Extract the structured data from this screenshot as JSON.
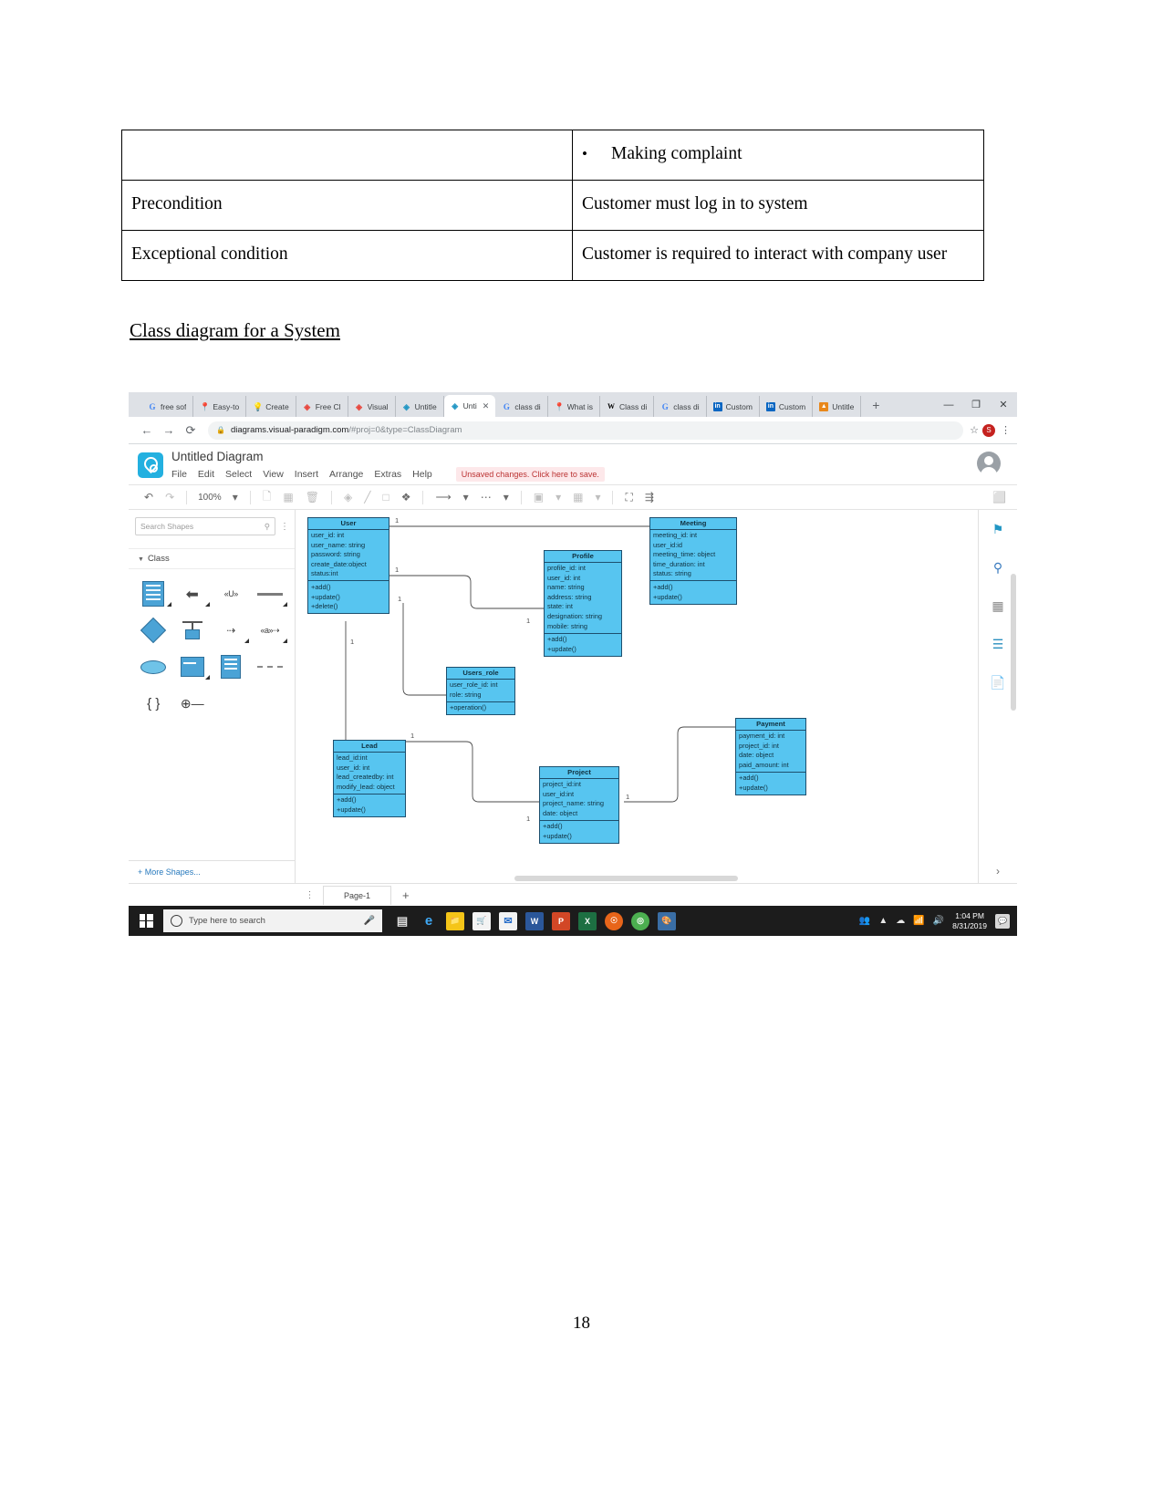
{
  "document": {
    "table_rows": [
      {
        "label": "",
        "value": "Making complaint",
        "is_bullet": true
      },
      {
        "label": "Precondition",
        "value": "Customer must log in to system",
        "is_bullet": false
      },
      {
        "label": "Exceptional condition",
        "value": "Customer is required to interact with company user",
        "is_bullet": false
      }
    ],
    "heading": "Class diagram for a System",
    "page_number": "18"
  },
  "browser": {
    "tabs": [
      {
        "label": "free sof",
        "icon": "google-icon",
        "active": false
      },
      {
        "label": "Easy-to",
        "icon": "pin-icon",
        "active": false
      },
      {
        "label": "Create",
        "icon": "bulb-icon",
        "active": false
      },
      {
        "label": "Free Cl",
        "icon": "visual-paradigm-icon",
        "active": false
      },
      {
        "label": "Visual",
        "icon": "visual-paradigm-icon",
        "active": false
      },
      {
        "label": "Untitle",
        "icon": "diagrams-icon",
        "active": false
      },
      {
        "label": "Unti",
        "icon": "diagrams-icon",
        "active": true
      },
      {
        "label": "class di",
        "icon": "google-icon",
        "active": false
      },
      {
        "label": "What is",
        "icon": "pin-icon",
        "active": false
      },
      {
        "label": "Class di",
        "icon": "wikipedia-icon",
        "active": false
      },
      {
        "label": "class di",
        "icon": "google-icon",
        "active": false
      },
      {
        "label": "Custom",
        "icon": "linkedin-icon",
        "active": false
      },
      {
        "label": "Custom",
        "icon": "linkedin-icon",
        "active": false
      },
      {
        "label": "Untitle",
        "icon": "orange-app-icon",
        "active": false
      }
    ],
    "new_tab_label": "+",
    "window_controls": {
      "minimize": "—",
      "maximize": "❐",
      "close": "✕"
    },
    "url_host": "diagrams.visual-paradigm.com",
    "url_path": "/#proj=0&type=ClassDiagram",
    "profile_initial": "S"
  },
  "app": {
    "title": "Untitled Diagram",
    "menu": [
      "File",
      "Edit",
      "Select",
      "View",
      "Insert",
      "Arrange",
      "Extras",
      "Help"
    ],
    "unsaved_notice": "Unsaved changes. Click here to save.",
    "toolbar": {
      "zoom": "100%",
      "undo": "↶",
      "redo": "↷"
    },
    "shapes_panel": {
      "search_placeholder": "Search Shapes",
      "group_label": "Class",
      "more_shapes_label": "+ More Shapes..."
    },
    "page_tab": "Page-1",
    "add_page_label": "+"
  },
  "diagram": {
    "classes": [
      {
        "name": "User",
        "attributes": [
          "user_id: int",
          "user_name: string",
          "password: string",
          "create_date:object",
          "status:int"
        ],
        "operations": [
          "+add()",
          "+update()",
          "+delete()"
        ]
      },
      {
        "name": "Meeting",
        "attributes": [
          "meeting_id: int",
          "user_id:id",
          "meeting_time: object",
          "time_duration: int",
          "status: string"
        ],
        "operations": [
          "+add()",
          "+update()"
        ]
      },
      {
        "name": "Profile",
        "attributes": [
          "profile_id: int",
          "user_id: int",
          "name: string",
          "address: string",
          "state: int",
          "designation: string",
          "mobile: string"
        ],
        "operations": [
          "+add()",
          "+update()"
        ]
      },
      {
        "name": "Users_role",
        "attributes": [
          "user_role_id: int",
          "role: string"
        ],
        "operations": [
          "+operation()"
        ]
      },
      {
        "name": "Lead",
        "attributes": [
          "lead_id:int",
          "user_id: int",
          "lead_createdby: int",
          "modify_lead: object"
        ],
        "operations": [
          "+add()",
          "+update()"
        ]
      },
      {
        "name": "Project",
        "attributes": [
          "project_id:int",
          "user_id:int",
          "project_name: string",
          "date: object"
        ],
        "operations": [
          "+add()",
          "+update()"
        ]
      },
      {
        "name": "Payment",
        "attributes": [
          "payment_id: int",
          "project_id: int",
          "date: object",
          "paid_amount: int"
        ],
        "operations": [
          "+add()",
          "+update()"
        ]
      }
    ],
    "multiplicities": [
      "1",
      "1",
      "1",
      "1",
      "1",
      "1",
      "1",
      "1"
    ]
  },
  "taskbar": {
    "search_placeholder": "Type here to search",
    "apps": [
      "task-view",
      "edge",
      "file-explorer",
      "microsoft-store",
      "mail",
      "word",
      "powerpoint",
      "excel",
      "firefox",
      "chrome",
      "paint-3d"
    ],
    "clock_time": "1:04 PM",
    "clock_date": "8/31/2019"
  },
  "colors": {
    "class_fill": "#57c5f0",
    "class_border": "#1d4f6e",
    "accent": "#23b0e0",
    "unsaved_bg": "#fde8ea"
  }
}
